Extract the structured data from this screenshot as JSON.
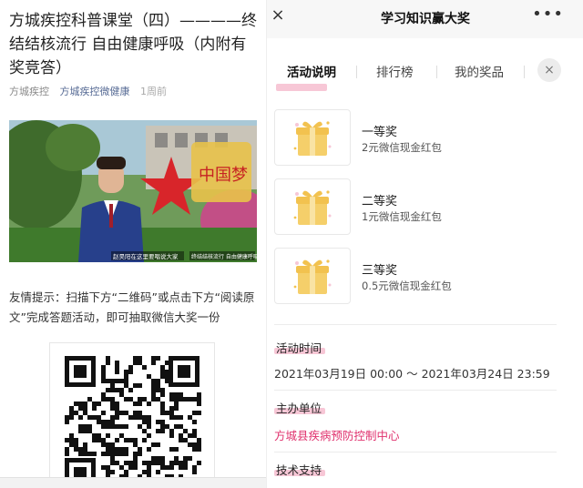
{
  "article": {
    "title": "方城疾控科普课堂（四）————终结结核流行 自由健康呼吸（内附有奖竞答）",
    "meta": {
      "author": "方城疾控",
      "account": "方城疾控微健康",
      "time": "1周前"
    },
    "video": {
      "caption_left": "赵昊阳在这里要唱说大家",
      "caption_right": "终结结核流行 自由健康呼吸",
      "sign_text": "中国梦"
    },
    "tip": "友情提示：扫描下方“二维码”或点击下方“阅读原文”完成答题活动，即可抽取微信大奖一份"
  },
  "activity": {
    "page_title": "学习知识赢大奖",
    "close_icon": "×",
    "more_icon": "•••",
    "tabs": [
      {
        "label": "活动说明",
        "active": true
      },
      {
        "label": "排行榜",
        "active": false
      },
      {
        "label": "我的奖品",
        "active": false
      }
    ],
    "tab_close_icon": "×",
    "prizes": [
      {
        "name": "一等奖",
        "desc": "2元微信现金红包"
      },
      {
        "name": "二等奖",
        "desc": "1元微信现金红包"
      },
      {
        "name": "三等奖",
        "desc": "0.5元微信现金红包"
      }
    ],
    "time_label": "活动时间",
    "time_value": "2021年03月19日 00:00 ～ 2021年03月24日 23:59",
    "organizer_label": "主办单位",
    "organizer_value": "方城县疾病预防控制中心",
    "support_label": "技术支持"
  },
  "colors": {
    "accent_pink": "#e0326e",
    "highlight_pink": "#f7c7d6",
    "link_blue": "#576b95",
    "gift_gold": "#f2c24f"
  },
  "icons": [
    "close-icon",
    "more-icon",
    "gift-box-icon",
    "qr-code"
  ]
}
